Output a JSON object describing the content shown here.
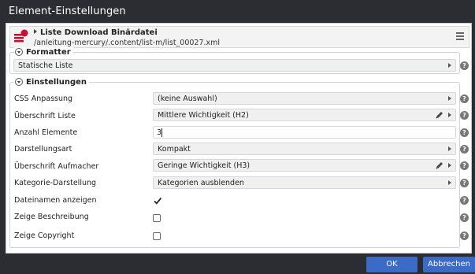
{
  "window": {
    "title": "Element-Einstellungen"
  },
  "resource": {
    "title": "Liste Download Binärdatei",
    "path": "/anleitung-mercury/.content/list-m/list_00027.xml",
    "icon": "list-resource-icon",
    "menu_icon": "hamburger-menu-icon"
  },
  "formatter": {
    "legend": "Formatter",
    "value": "Statische Liste"
  },
  "settings": {
    "legend": "Einstellungen",
    "fields": [
      {
        "label": "CSS Anpassung",
        "type": "select",
        "value": "(keine Auswahl)"
      },
      {
        "label": "Überschrift Liste",
        "type": "select",
        "value": "Mittlere Wichtigkeit (H2)",
        "editable": true
      },
      {
        "label": "Anzahl Elemente",
        "type": "text",
        "value": "3"
      },
      {
        "label": "Darstellungsart",
        "type": "select",
        "value": "Kompakt"
      },
      {
        "label": "Überschrift Aufmacher",
        "type": "select",
        "value": "Geringe Wichtigkeit (H3)",
        "editable": true
      },
      {
        "label": "Kategorie-Darstellung",
        "type": "select",
        "value": "Kategorien ausblenden"
      },
      {
        "label": "Dateinamen anzeigen",
        "type": "checkbox",
        "checked": true
      },
      {
        "label": "Zeige Beschreibung",
        "type": "checkbox",
        "checked": false
      },
      {
        "label": "Zeige Copyright",
        "type": "checkbox",
        "checked": false
      }
    ]
  },
  "buttons": {
    "ok": "OK",
    "cancel": "Abbrechen"
  },
  "help_glyph": "?",
  "colors": {
    "titlebar": "#2b2d32",
    "button": "#3b6bc7",
    "icon_red": "#c8102e"
  }
}
